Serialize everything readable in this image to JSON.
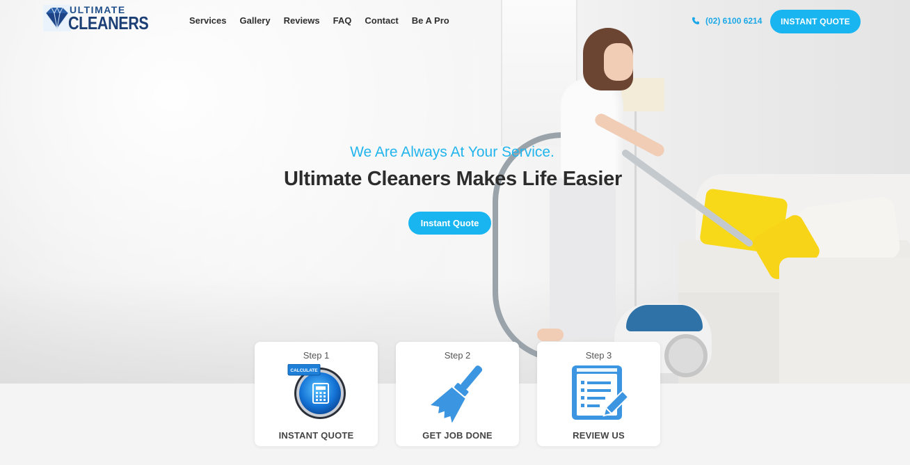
{
  "header": {
    "logo": {
      "line1": "ULTIMATE",
      "line2": "CLEANERS"
    },
    "nav": [
      "Services",
      "Gallery",
      "Reviews",
      "FAQ",
      "Contact",
      "Be A Pro"
    ],
    "phone": "(02) 6100 6214",
    "phone_icon": "phone-icon",
    "cta_label": "INSTANT QUOTE"
  },
  "hero": {
    "tagline": "We Are Always At Your Service.",
    "headline": "Ultimate Cleaners Makes Life Easier",
    "cta_label": "Instant Quote"
  },
  "steps": [
    {
      "label": "Step 1",
      "title": "INSTANT QUOTE",
      "icon": "calculator-icon",
      "icon_badge": "CALCULATE"
    },
    {
      "label": "Step 2",
      "title": "GET JOB DONE",
      "icon": "broom-icon"
    },
    {
      "label": "Step 3",
      "title": "REVIEW US",
      "icon": "form-edit-icon"
    }
  ],
  "colors": {
    "accent": "#18b5f0",
    "tagline": "#22b4ec",
    "headline": "#2c2c2c",
    "logo_blue": "#1b3f74",
    "icon_blue": "#3b95e0"
  }
}
